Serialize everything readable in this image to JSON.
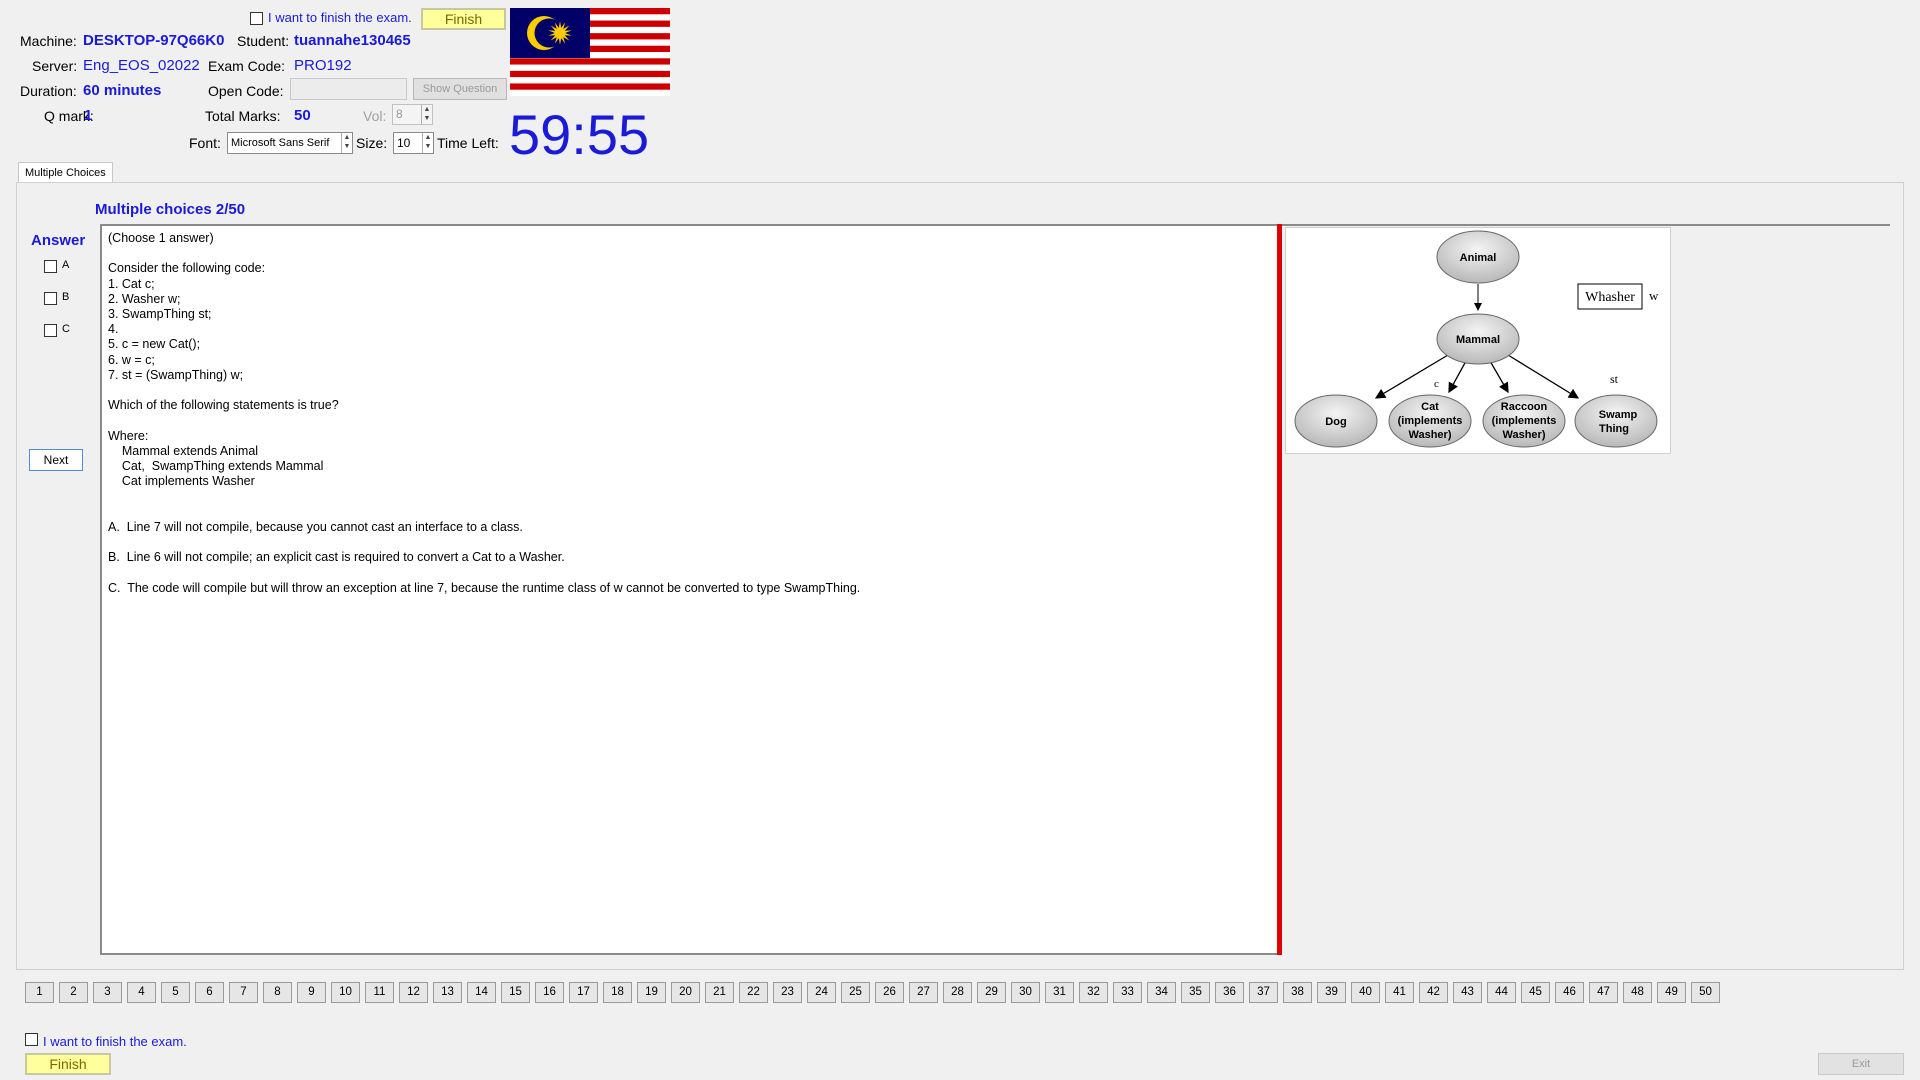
{
  "header": {
    "finish_check_label": "I want to finish the exam.",
    "finish_button": "Finish",
    "machine_label": "Machine:",
    "machine_value": "DESKTOP-97Q66K0",
    "student_label": "Student:",
    "student_value": "tuannahe130465",
    "server_label": "Server:",
    "server_value": "Eng_EOS_02022",
    "exam_code_label": "Exam Code:",
    "exam_code_value": "PRO192",
    "duration_label": "Duration:",
    "duration_value": "60 minutes",
    "open_code_label": "Open Code:",
    "open_code_value": "",
    "show_question_button": "Show Question",
    "qmark_label": "Q mark:",
    "qmark_value": "1",
    "total_marks_label": "Total Marks:",
    "total_marks_value": "50",
    "vol_label": "Vol:",
    "vol_value": "8",
    "font_label": "Font:",
    "font_value": "Microsoft Sans Serif",
    "size_label": "Size:",
    "size_value": "10",
    "time_left_label": "Time Left:",
    "timer": "59:55"
  },
  "tab": {
    "label": "Multiple Choices"
  },
  "question": {
    "title": "Multiple choices 2/50",
    "answer_label": "Answer",
    "options": [
      "A",
      "B",
      "C"
    ],
    "next_button": "Next",
    "lines": [
      "(Choose 1 answer)",
      "",
      "Consider the following code:",
      "1. Cat c;",
      "2. Washer w;",
      "3. SwampThing st;",
      "4.",
      "5. c = new Cat();",
      "6. w = c;",
      "7. st = (SwampThing) w;",
      "",
      "Which of the following statements is true?",
      "",
      "Where:",
      "    Mammal extends Animal",
      "    Cat,  SwampThing extends Mammal",
      "    Cat implements Washer",
      "",
      "",
      "A.  Line 7 will not compile, because you cannot cast an interface to a class.",
      "",
      "B.  Line 6 will not compile; an explicit cast is required to convert a Cat to a Washer.",
      "",
      "C.  The code will compile but will throw an exception at line 7, because the runtime class of w cannot be converted to type SwampThing."
    ]
  },
  "diagram": {
    "animal": "Animal",
    "mammal": "Mammal",
    "dog": "Dog",
    "cat_l1": "Cat",
    "cat_l2": "(implements",
    "cat_l3": "Washer)",
    "raccoon_l1": "Raccoon",
    "raccoon_l2": "(implements",
    "raccoon_l3": "Washer)",
    "swamp_l1": "Swamp",
    "swamp_l2": "Thing",
    "washer_box": "Whasher",
    "w_label": "w",
    "c_label": "c",
    "st_label": "st"
  },
  "nav": {
    "numbers": [
      "1",
      "2",
      "3",
      "4",
      "5",
      "6",
      "7",
      "8",
      "9",
      "10",
      "11",
      "12",
      "13",
      "14",
      "15",
      "16",
      "17",
      "18",
      "19",
      "20",
      "21",
      "22",
      "23",
      "24",
      "25",
      "26",
      "27",
      "28",
      "29",
      "30",
      "31",
      "32",
      "33",
      "34",
      "35",
      "36",
      "37",
      "38",
      "39",
      "40",
      "41",
      "42",
      "43",
      "44",
      "45",
      "46",
      "47",
      "48",
      "49",
      "50"
    ]
  },
  "footer": {
    "finish_check_label": "I want to finish the exam.",
    "finish_button": "Finish",
    "exit_button": "Exit"
  },
  "colors": {
    "accent": "#1a1ad9",
    "finish_bg": "#ffff9c",
    "red_bar": "#e00000",
    "flag_blue": "#010066",
    "flag_red": "#cc0001",
    "flag_yellow": "#ffcc00"
  }
}
